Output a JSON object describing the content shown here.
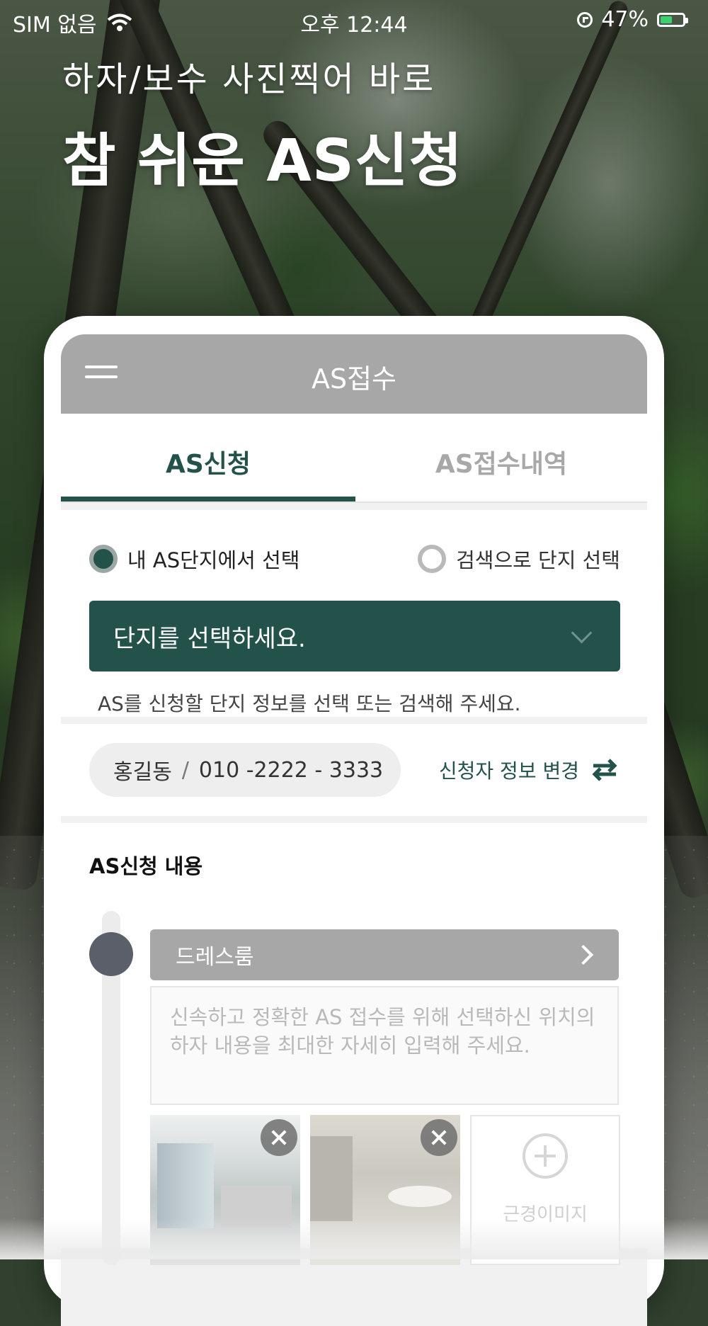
{
  "status_bar": {
    "carrier": "SIM 없음",
    "time": "오후 12:44",
    "battery": "47%"
  },
  "headline": {
    "subtitle": "하자/보수 사진찍어 바로",
    "title": "참 쉬운 AS신청"
  },
  "app": {
    "header_title": "AS접수",
    "tabs": [
      {
        "label": "AS신청",
        "active": true
      },
      {
        "label": "AS접수내역",
        "active": false
      }
    ],
    "site_select": {
      "radio_mine": "내 AS단지에서 선택",
      "radio_search": "검색으로 단지 선택",
      "selected_option": "radio_mine",
      "dropdown_value": "단지를 선택하세요.",
      "help_text": "AS를 신청할 단지 정보를 선택 또는 검색해 주세요."
    },
    "applicant": {
      "name": "홍길동",
      "separator": "/",
      "phone": "010 -2222 - 3333",
      "change_label": "신청자 정보 변경"
    },
    "content": {
      "section_title": "AS신청 내용",
      "location": "드레스룸",
      "memo_placeholder_line1": "신속하고 정확한 AS 접수를 위해 선택하신 위치의",
      "memo_placeholder_line2": "하자 내용을 최대한 자세히 입력해 주세요.",
      "add_image_label": "근경이미지"
    }
  },
  "colors": {
    "brand_green": "#23524b",
    "header_gray": "#a7a7a7",
    "battery_green": "#3bd16f"
  }
}
